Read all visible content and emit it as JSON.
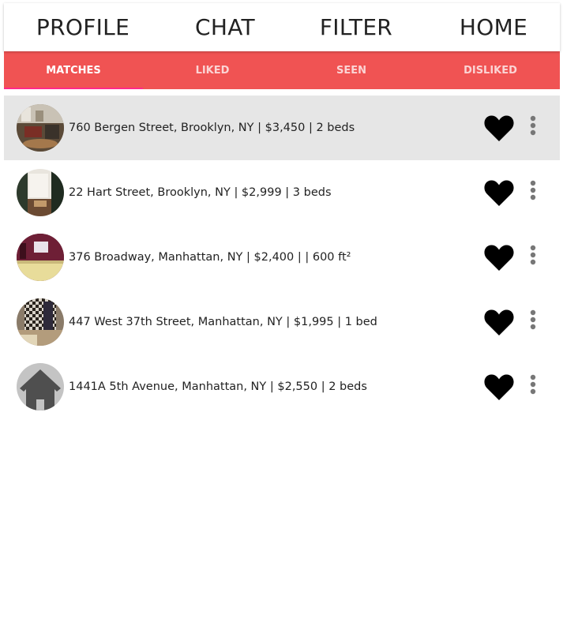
{
  "nav": {
    "items": [
      {
        "label": "PROFILE"
      },
      {
        "label": "CHAT"
      },
      {
        "label": "FILTER"
      },
      {
        "label": "HOME"
      }
    ]
  },
  "tabs": {
    "active": 0,
    "items": [
      {
        "label": "MATCHES"
      },
      {
        "label": "LIKED"
      },
      {
        "label": "SEEN"
      },
      {
        "label": "DISLIKED"
      }
    ]
  },
  "listings": [
    {
      "text": "760 Bergen Street, Brooklyn, NY | $3,450 | 2 beds",
      "selected": true,
      "liked": true
    },
    {
      "text": "22 Hart Street, Brooklyn, NY | $2,999 | 3 beds",
      "selected": false,
      "liked": true
    },
    {
      "text": "376 Broadway, Manhattan, NY | $2,400 | | 600 ft²",
      "selected": false,
      "liked": true
    },
    {
      "text": "447 West 37th Street, Manhattan, NY | $1,995 | 1 bed",
      "selected": false,
      "liked": true
    },
    {
      "text": "1441A 5th Avenue, Manhattan, NY | $2,550 | 2 beds",
      "selected": false,
      "liked": true
    }
  ],
  "icons": {
    "heart": "heart-icon",
    "more": "more-vertical-icon",
    "placeholder": "house-placeholder-icon"
  },
  "colors": {
    "tab_bar": "#f05353",
    "tab_indicator": "#ff2a8a",
    "selected_row": "#e6e6e6"
  }
}
